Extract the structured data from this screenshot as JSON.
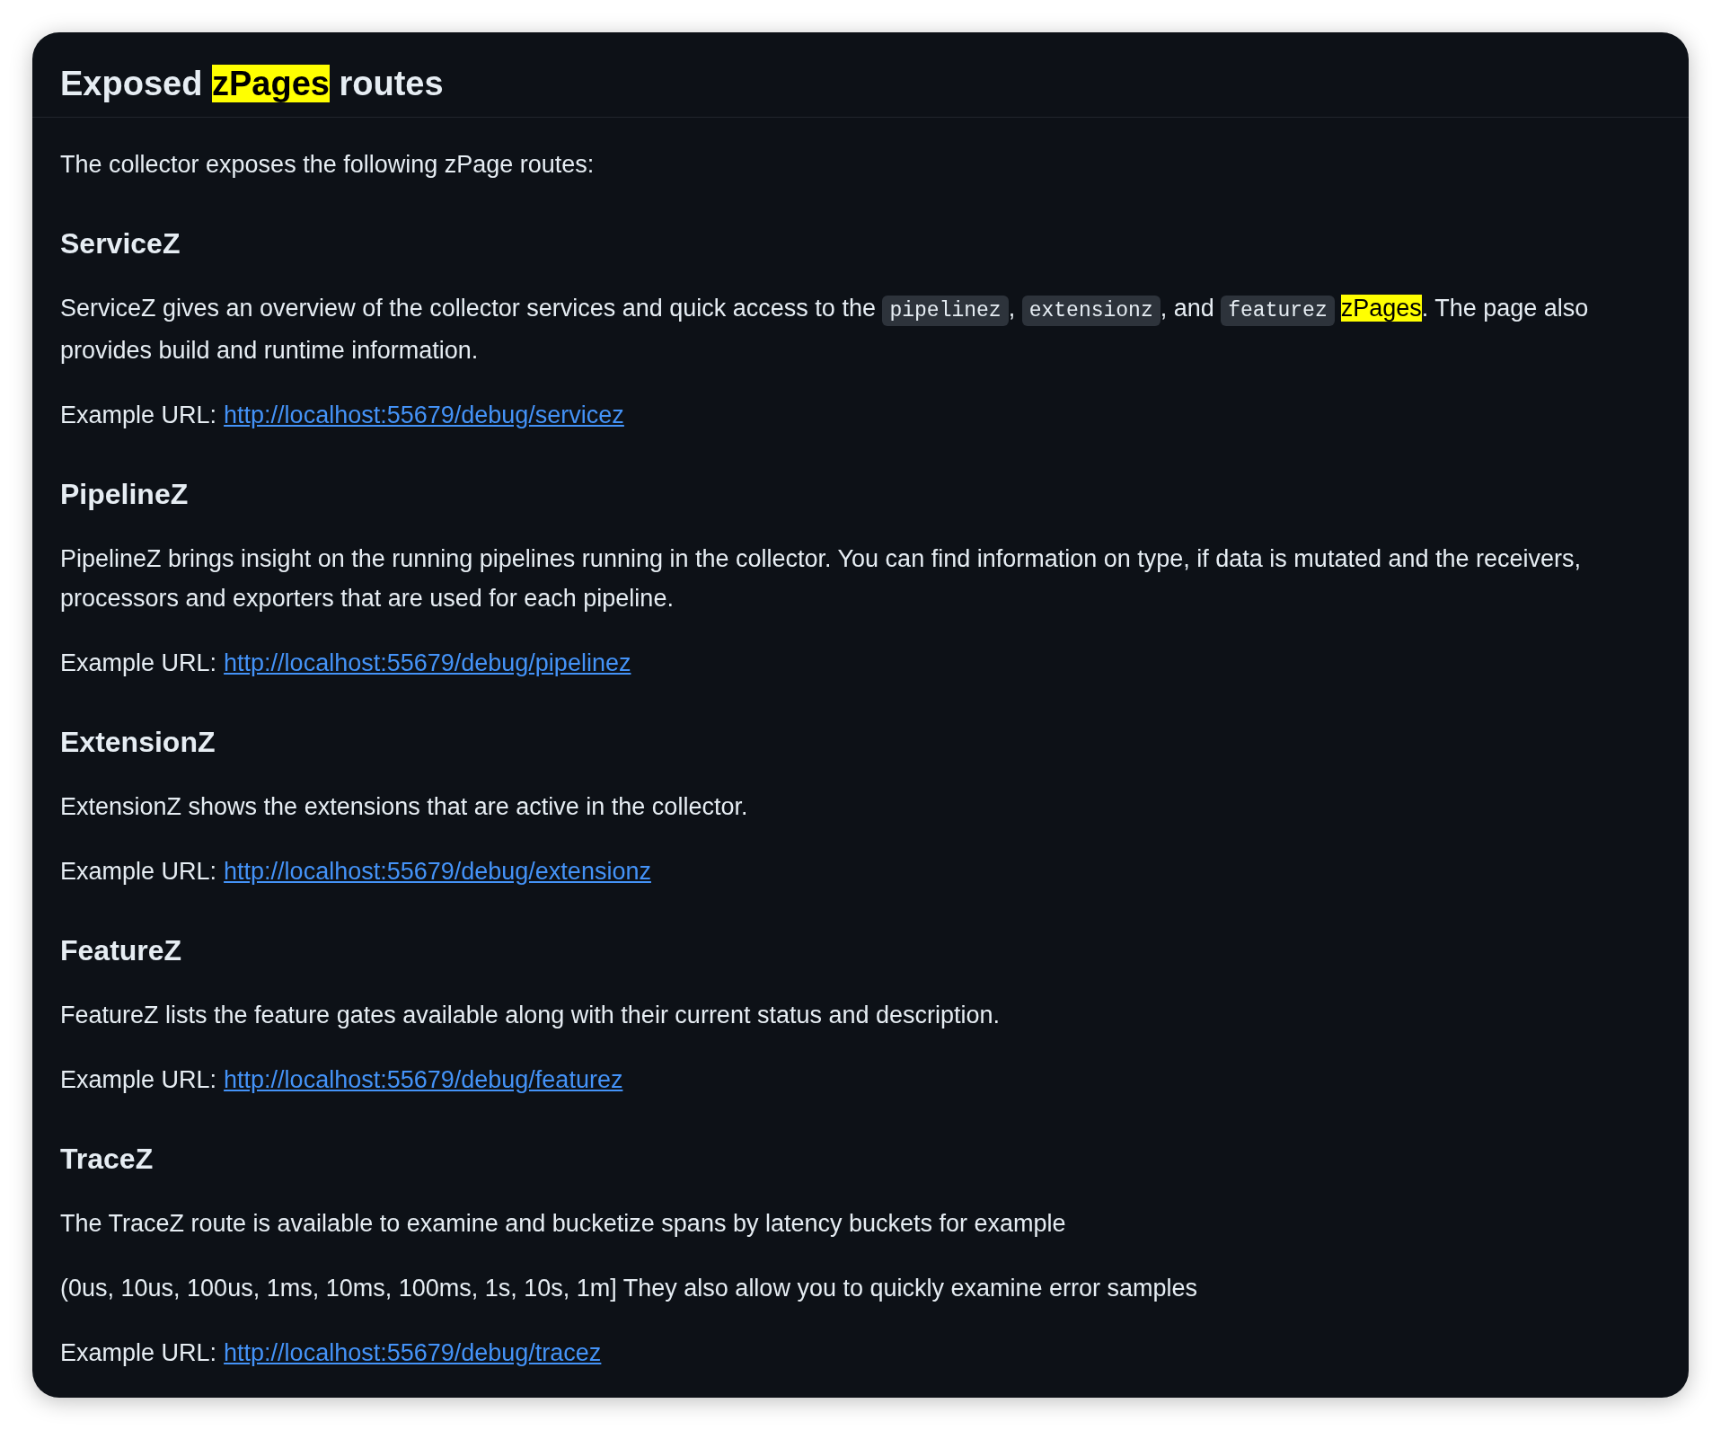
{
  "title": [
    {
      "kind": "text",
      "text": "Exposed "
    },
    {
      "kind": "highlight",
      "text": "zPages"
    },
    {
      "kind": "text",
      "text": " routes"
    }
  ],
  "intro": "The collector exposes the following zPage routes:",
  "sections": [
    {
      "heading": "ServiceZ",
      "paragraphs": [
        [
          {
            "kind": "text",
            "text": "ServiceZ gives an overview of the collector services and quick access to the "
          },
          {
            "kind": "code",
            "text": "pipelinez"
          },
          {
            "kind": "text",
            "text": ", "
          },
          {
            "kind": "code",
            "text": "extensionz"
          },
          {
            "kind": "text",
            "text": ", and "
          },
          {
            "kind": "code",
            "text": "featurez"
          },
          {
            "kind": "highlight",
            "text": "zPages"
          },
          {
            "kind": "text",
            "text": ". The page also provides build and runtime information."
          }
        ]
      ],
      "example": {
        "label": "Example URL:",
        "url": "http://localhost:55679/debug/servicez"
      }
    },
    {
      "heading": "PipelineZ",
      "paragraphs": [
        [
          {
            "kind": "text",
            "text": "PipelineZ brings insight on the running pipelines running in the collector. You can find information on type, if data is mutated and the receivers, processors and exporters that are used for each pipeline."
          }
        ]
      ],
      "example": {
        "label": "Example URL:",
        "url": "http://localhost:55679/debug/pipelinez"
      }
    },
    {
      "heading": "ExtensionZ",
      "paragraphs": [
        [
          {
            "kind": "text",
            "text": "ExtensionZ shows the extensions that are active in the collector."
          }
        ]
      ],
      "example": {
        "label": "Example URL:",
        "url": "http://localhost:55679/debug/extensionz"
      }
    },
    {
      "heading": "FeatureZ",
      "paragraphs": [
        [
          {
            "kind": "text",
            "text": "FeatureZ lists the feature gates available along with their current status and description."
          }
        ]
      ],
      "example": {
        "label": "Example URL:",
        "url": "http://localhost:55679/debug/featurez"
      }
    },
    {
      "heading": "TraceZ",
      "paragraphs": [
        [
          {
            "kind": "text",
            "text": "The TraceZ route is available to examine and bucketize spans by latency buckets for example"
          }
        ],
        [
          {
            "kind": "text",
            "text": "(0us, 10us, 100us, 1ms, 10ms, 100ms, 1s, 10s, 1m] They also allow you to quickly examine error samples"
          }
        ]
      ],
      "example": {
        "label": "Example URL:",
        "url": "http://localhost:55679/debug/tracez"
      }
    }
  ]
}
